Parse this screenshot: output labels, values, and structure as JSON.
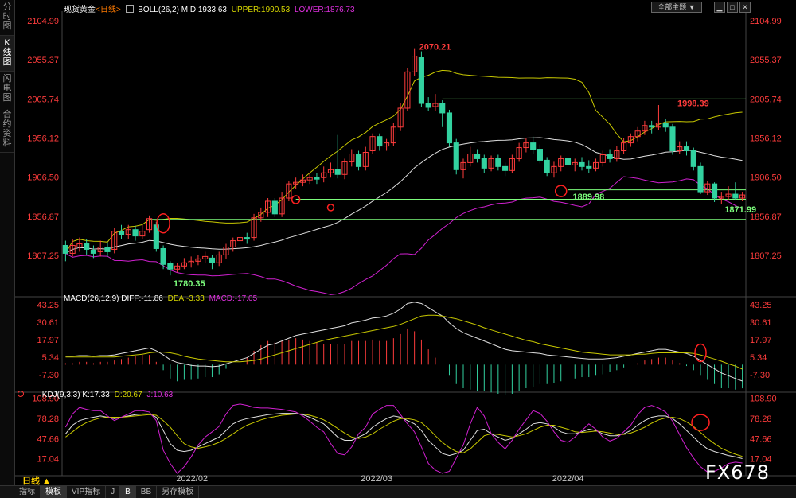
{
  "window": {
    "symbol": "现货黄金",
    "period_tag": "<日线>",
    "theme_button": "全部主题",
    "theme_arrow": "▼"
  },
  "left_tabs": [
    {
      "label": "分\n时\n图",
      "active": false
    },
    {
      "label": "K\n线\n图",
      "active": true
    },
    {
      "label": "闪\n电\n图",
      "active": false
    },
    {
      "label": "合\n约\n资\n料",
      "active": false
    }
  ],
  "price_panel": {
    "indicator": "BOLL(26,2)",
    "mid": "MID:1933.63",
    "upper": "UPPER:1990.53",
    "lower": "LOWER:1876.73",
    "y_ticks": [
      "2104.99",
      "2055.37",
      "2005.74",
      "1956.12",
      "1906.50",
      "1856.87",
      "1807.25"
    ],
    "annotations": {
      "high": "2070.21",
      "high2": "1998.39",
      "low": "1780.35",
      "low2": "1889.98",
      "low3": "1871.99"
    }
  },
  "macd_panel": {
    "indicator": "MACD(26,12,9)",
    "diff": "DIFF:-11.86",
    "dea": "DEA:-3.33",
    "macd": "MACD:-17.05",
    "y_ticks": [
      "43.25",
      "30.61",
      "17.97",
      "5.34",
      "-7.30"
    ]
  },
  "kdj_panel": {
    "indicator": "KDJ(9,3,3)",
    "k": "K:17.33",
    "d": "D:20.67",
    "j": "J:10.63",
    "y_ticks": [
      "108.90",
      "78.28",
      "47.66",
      "17.04"
    ]
  },
  "x_axis": {
    "labels": [
      "2022/02",
      "2022/03",
      "2022/04"
    ]
  },
  "bottom_bar": {
    "period": "日线 ▲",
    "tabs": [
      {
        "label": "指标",
        "active": false
      },
      {
        "label": "模板",
        "active": true
      },
      {
        "label": "VIP指标",
        "active": false
      },
      {
        "label": "J",
        "active": false
      },
      {
        "label": "B",
        "active": true
      },
      {
        "label": "BB",
        "active": false
      },
      {
        "label": "另存模板",
        "active": false
      }
    ]
  },
  "watermark": "FX678",
  "colors": {
    "up": "#ff3c3c",
    "down": "#32d2a0",
    "mid": "#e0e0e0",
    "upper": "#c8c800",
    "lower": "#d020d0",
    "axis_text": "#ff3c3c",
    "hline": "#7cfc7c",
    "marker": "#ff2020"
  },
  "chart_data": {
    "type": "candlestick",
    "title": "现货黄金<日线>",
    "price_range": [
      1760,
      2115
    ],
    "horizontal_lines": [
      2005.74,
      1890.5,
      1878.5,
      1853
    ],
    "candles": [
      [
        1820,
        1810,
        1826,
        1800
      ],
      [
        1810,
        1820,
        1828,
        1806
      ],
      [
        1818,
        1822,
        1830,
        1812
      ],
      [
        1822,
        1815,
        1828,
        1808
      ],
      [
        1814,
        1810,
        1820,
        1804
      ],
      [
        1812,
        1818,
        1826,
        1806
      ],
      [
        1818,
        1812,
        1824,
        1806
      ],
      [
        1815,
        1838,
        1842,
        1810
      ],
      [
        1838,
        1834,
        1846,
        1828
      ],
      [
        1834,
        1840,
        1846,
        1828
      ],
      [
        1840,
        1832,
        1845,
        1826
      ],
      [
        1832,
        1838,
        1846,
        1828
      ],
      [
        1840,
        1854,
        1858,
        1836
      ],
      [
        1846,
        1816,
        1850,
        1812
      ],
      [
        1816,
        1796,
        1820,
        1790
      ],
      [
        1797,
        1790,
        1800,
        1782
      ],
      [
        1790,
        1794,
        1798,
        1786
      ],
      [
        1794,
        1798,
        1804,
        1790
      ],
      [
        1798,
        1800,
        1806,
        1792
      ],
      [
        1800,
        1803,
        1808,
        1795
      ],
      [
        1803,
        1806,
        1812,
        1798
      ],
      [
        1804,
        1798,
        1808,
        1790
      ],
      [
        1798,
        1808,
        1812,
        1794
      ],
      [
        1808,
        1818,
        1822,
        1803
      ],
      [
        1818,
        1826,
        1830,
        1812
      ],
      [
        1826,
        1830,
        1836,
        1820
      ],
      [
        1830,
        1828,
        1836,
        1822
      ],
      [
        1830,
        1855,
        1860,
        1826
      ],
      [
        1855,
        1862,
        1868,
        1850
      ],
      [
        1862,
        1876,
        1880,
        1856
      ],
      [
        1876,
        1860,
        1880,
        1856
      ],
      [
        1860,
        1880,
        1888,
        1856
      ],
      [
        1880,
        1898,
        1902,
        1876
      ],
      [
        1898,
        1900,
        1906,
        1892
      ],
      [
        1900,
        1903,
        1910,
        1895
      ],
      [
        1903,
        1906,
        1912,
        1898
      ],
      [
        1906,
        1904,
        1912,
        1898
      ],
      [
        1906,
        1912,
        1920,
        1900
      ],
      [
        1912,
        1916,
        1925,
        1906
      ],
      [
        1916,
        1910,
        1960,
        1905
      ],
      [
        1910,
        1926,
        1930,
        1904
      ],
      [
        1926,
        1936,
        1942,
        1920
      ],
      [
        1936,
        1920,
        1940,
        1915
      ],
      [
        1920,
        1938,
        1945,
        1915
      ],
      [
        1940,
        1958,
        1962,
        1936
      ],
      [
        1958,
        1946,
        1962,
        1940
      ],
      [
        1946,
        1950,
        1955,
        1940
      ],
      [
        1950,
        1970,
        1975,
        1946
      ],
      [
        1970,
        1994,
        2000,
        1965
      ],
      [
        1994,
        2040,
        2045,
        1990
      ],
      [
        2040,
        2060,
        2070,
        2035
      ],
      [
        2058,
        2000,
        2066,
        1996
      ],
      [
        2000,
        1995,
        2008,
        1990
      ],
      [
        1996,
        2000,
        2012,
        1990
      ],
      [
        2000,
        1988,
        2004,
        1970
      ],
      [
        1988,
        1950,
        1992,
        1945
      ],
      [
        1950,
        1916,
        1955,
        1910
      ],
      [
        1916,
        1925,
        1930,
        1905
      ],
      [
        1925,
        1936,
        1945,
        1920
      ],
      [
        1936,
        1930,
        1942,
        1925
      ],
      [
        1930,
        1918,
        1935,
        1912
      ],
      [
        1918,
        1930,
        1934,
        1914
      ],
      [
        1930,
        1920,
        1935,
        1915
      ],
      [
        1920,
        1915,
        1925,
        1908
      ],
      [
        1915,
        1930,
        1935,
        1912
      ],
      [
        1930,
        1944,
        1950,
        1926
      ],
      [
        1944,
        1950,
        1956,
        1938
      ],
      [
        1950,
        1942,
        1958,
        1936
      ],
      [
        1942,
        1928,
        1948,
        1924
      ],
      [
        1928,
        1912,
        1932,
        1908
      ],
      [
        1912,
        1920,
        1926,
        1906
      ],
      [
        1920,
        1930,
        1934,
        1914
      ],
      [
        1930,
        1922,
        1935,
        1918
      ],
      [
        1922,
        1925,
        1930,
        1914
      ],
      [
        1925,
        1920,
        1932,
        1915
      ],
      [
        1920,
        1918,
        1928,
        1912
      ],
      [
        1918,
        1925,
        1930,
        1914
      ],
      [
        1925,
        1935,
        1940,
        1920
      ],
      [
        1935,
        1930,
        1942,
        1925
      ],
      [
        1930,
        1940,
        1946,
        1926
      ],
      [
        1940,
        1950,
        1956,
        1936
      ],
      [
        1950,
        1958,
        1962,
        1945
      ],
      [
        1958,
        1965,
        1970,
        1952
      ],
      [
        1965,
        1972,
        1978,
        1960
      ],
      [
        1972,
        1970,
        1978,
        1962
      ],
      [
        1970,
        1975,
        1998,
        1966
      ],
      [
        1975,
        1970,
        1980,
        1964
      ],
      [
        1970,
        1940,
        1974,
        1935
      ],
      [
        1940,
        1945,
        1952,
        1936
      ],
      [
        1945,
        1940,
        1952,
        1934
      ],
      [
        1940,
        1920,
        1944,
        1915
      ],
      [
        1920,
        1888,
        1925,
        1885
      ],
      [
        1888,
        1898,
        1902,
        1884
      ],
      [
        1898,
        1880,
        1900,
        1875
      ],
      [
        1880,
        1882,
        1888,
        1872
      ],
      [
        1882,
        1885,
        1895,
        1878
      ],
      [
        1885,
        1880,
        1900,
        1878
      ],
      [
        1880,
        1884,
        1888,
        1876
      ]
    ],
    "macd_range": [
      -17,
      46
    ],
    "diff": [
      6,
      6,
      6.5,
      6.5,
      6,
      6.5,
      6.5,
      7,
      8,
      9,
      10,
      11,
      12,
      10,
      7,
      3.5,
      1.5,
      0.5,
      -0.5,
      -1,
      -1,
      -1.5,
      -1,
      0.5,
      2,
      3.5,
      5,
      8,
      11,
      14,
      15,
      17,
      19,
      21,
      22,
      23,
      24,
      25,
      26,
      27,
      28,
      30,
      31,
      32,
      33.5,
      34,
      35,
      37,
      40,
      44,
      45,
      44,
      41,
      38,
      35,
      30,
      26,
      23,
      21,
      19,
      17,
      15,
      13,
      11,
      10,
      9.5,
      9,
      8.5,
      8,
      7,
      6.5,
      6,
      5.5,
      5,
      4.5,
      4,
      4,
      4,
      4.5,
      5,
      6,
      7,
      8,
      9,
      10,
      11,
      11,
      10,
      9,
      8,
      6,
      3,
      0,
      -3,
      -6,
      -8,
      -10,
      -11.86
    ],
    "dea": [
      5.5,
      5.5,
      5.5,
      5.5,
      5.5,
      5.5,
      5.5,
      5.5,
      6,
      6.5,
      7,
      7.5,
      8.5,
      9,
      9,
      8.5,
      7.5,
      6,
      5,
      4,
      3.5,
      3,
      2.5,
      2,
      2,
      2,
      2.5,
      3,
      4,
      5.5,
      7,
      8.5,
      10,
      11.5,
      13,
      14.5,
      16,
      17.5,
      18.5,
      19.5,
      20.5,
      21.5,
      22.5,
      23.5,
      24.5,
      25.5,
      26.5,
      27.5,
      29,
      31,
      33,
      35,
      35.5,
      35.5,
      35,
      34,
      33,
      31.5,
      30,
      28.5,
      26.5,
      25,
      23.5,
      22,
      20.5,
      19,
      17.5,
      16.5,
      15,
      14,
      13,
      12,
      11,
      10,
      9,
      8.5,
      8,
      7.5,
      7,
      7,
      7,
      7,
      7.5,
      7.5,
      8,
      8.5,
      8.5,
      8.5,
      8.5,
      8.5,
      8,
      7,
      5.5,
      4,
      2.5,
      0.5,
      -1,
      -3.33
    ],
    "kdj_range": [
      -5,
      112
    ],
    "k": [
      55,
      68,
      75,
      78,
      80,
      82,
      80,
      78,
      80,
      82,
      84,
      85,
      85,
      80,
      60,
      40,
      30,
      28,
      30,
      35,
      40,
      45,
      50,
      60,
      70,
      75,
      78,
      80,
      82,
      84,
      85,
      86,
      86,
      86,
      84,
      80,
      75,
      70,
      60,
      50,
      45,
      45,
      50,
      55,
      65,
      72,
      78,
      82,
      80,
      75,
      70,
      60,
      45,
      35,
      25,
      22,
      25,
      30,
      45,
      60,
      62,
      55,
      50,
      45,
      48,
      55,
      62,
      70,
      72,
      70,
      65,
      58,
      55,
      55,
      58,
      62,
      60,
      55,
      52,
      52,
      55,
      60,
      68,
      75,
      80,
      82,
      82,
      78,
      70,
      60,
      50,
      40,
      32,
      28,
      25,
      22,
      20,
      17.33
    ],
    "d": [
      50,
      58,
      66,
      72,
      76,
      79,
      80,
      80,
      80,
      81,
      82,
      83,
      84,
      83,
      75,
      65,
      52,
      40,
      35,
      33,
      35,
      38,
      42,
      48,
      55,
      62,
      68,
      72,
      76,
      79,
      81,
      83,
      84,
      85,
      85,
      83,
      80,
      76,
      70,
      63,
      56,
      50,
      48,
      50,
      55,
      62,
      68,
      74,
      78,
      78,
      76,
      72,
      63,
      52,
      42,
      34,
      28,
      26,
      32,
      42,
      52,
      55,
      54,
      52,
      50,
      52,
      55,
      60,
      65,
      68,
      68,
      65,
      62,
      58,
      57,
      58,
      59,
      58,
      56,
      54,
      54,
      56,
      60,
      65,
      71,
      76,
      79,
      80,
      78,
      73,
      66,
      57,
      48,
      40,
      33,
      28,
      24,
      20.67
    ],
    "j": [
      65,
      85,
      95,
      92,
      90,
      90,
      82,
      75,
      80,
      85,
      90,
      90,
      88,
      75,
      30,
      10,
      -5,
      5,
      20,
      38,
      50,
      58,
      66,
      85,
      98,
      100,
      98,
      95,
      94,
      94,
      93,
      92,
      90,
      88,
      82,
      74,
      65,
      58,
      40,
      25,
      23,
      35,
      55,
      65,
      85,
      92,
      98,
      98,
      84,
      70,
      58,
      35,
      10,
      0,
      -5,
      -2,
      18,
      38,
      70,
      95,
      82,
      55,
      42,
      32,
      45,
      62,
      76,
      90,
      86,
      74,
      58,
      45,
      42,
      50,
      60,
      70,
      62,
      50,
      44,
      48,
      58,
      68,
      84,
      95,
      98,
      94,
      88,
      74,
      54,
      34,
      18,
      5,
      -3,
      -2,
      3,
      10,
      12,
      10.63
    ]
  }
}
